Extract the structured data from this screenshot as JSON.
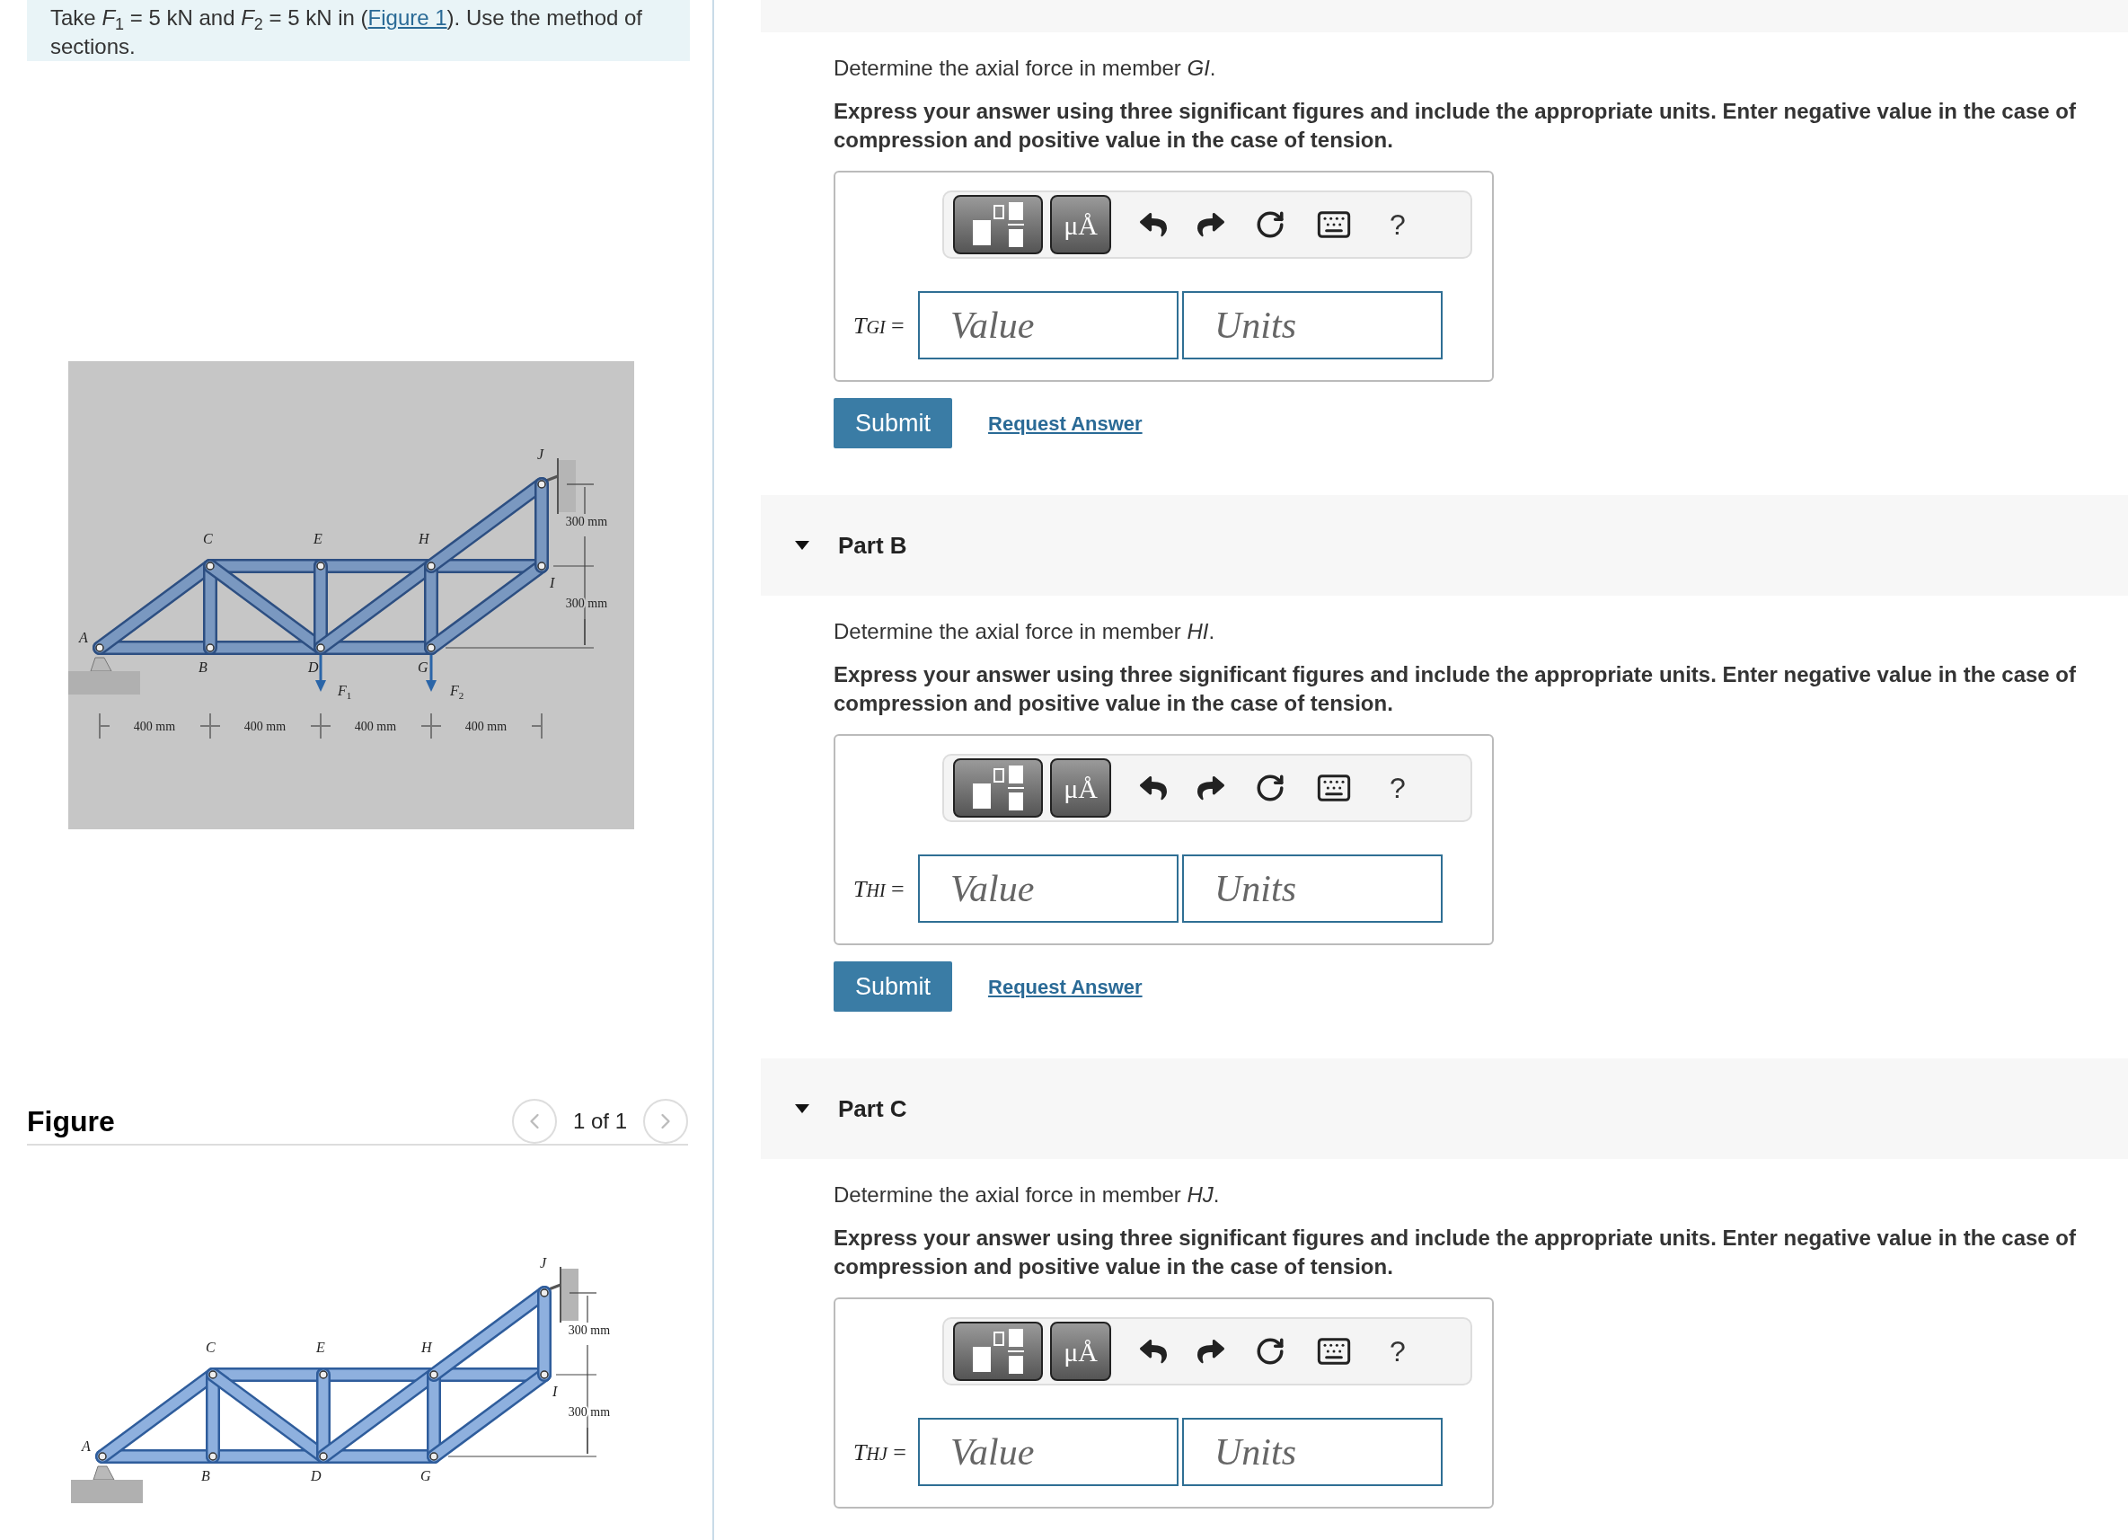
{
  "problem": {
    "before": "Take *F*$_{1}$ = 5 kN and *F*$_{2}$ = 5 kN in (",
    "link": "Figure 1",
    "after": "). Use the method of sections."
  },
  "figure_top": {
    "node_labels": [
      "A",
      "B",
      "C",
      "D",
      "E",
      "G",
      "H",
      "I",
      "J"
    ],
    "loads": [
      {
        "symbol": "F",
        "subscript": "1"
      },
      {
        "symbol": "F",
        "subscript": "2"
      }
    ],
    "horizontal_dimensions": [
      "400 mm",
      "400 mm",
      "400 mm",
      "400 mm"
    ],
    "vertical_dimensions": [
      "300 mm",
      "300 mm"
    ]
  },
  "figure_panel": {
    "title": "Figure",
    "pager": "1 of 1"
  },
  "figure_bottom": {
    "node_labels": [
      "A",
      "B",
      "C",
      "D",
      "E",
      "G",
      "H",
      "I",
      "J"
    ],
    "vertical_dimensions": [
      "300 mm",
      "300 mm"
    ]
  },
  "parts": [
    {
      "prompt": "Determine the axial force in member *GI*.",
      "instruction": "Express your answer using three significant figures and include the appropriate units. Enter negative value in the case of compression and positive value in the case of tension.",
      "templates_label": "μÅ",
      "help": "?",
      "symbol": "T",
      "subscript": "GI",
      "equals": "=",
      "value_placeholder": "Value",
      "units_placeholder": "Units",
      "submit": "Submit",
      "request": "Request Answer"
    },
    {
      "header": {
        "title": "Part B",
        "expanded": true
      },
      "prompt": "Determine the axial force in member *HI*.",
      "instruction": "Express your answer using three significant figures and include the appropriate units. Enter negative value in the case of compression and positive value in the case of tension.",
      "templates_label": "μÅ",
      "help": "?",
      "symbol": "T",
      "subscript": "HI",
      "equals": "=",
      "value_placeholder": "Value",
      "units_placeholder": "Units",
      "submit": "Submit",
      "request": "Request Answer"
    },
    {
      "header": {
        "title": "Part C",
        "expanded": true
      },
      "prompt": "Determine the axial force in member *HJ*.",
      "instruction": "Express your answer using three significant figures and include the appropriate units. Enter negative value in the case of compression and positive value in the case of tension.",
      "templates_label": "μÅ",
      "help": "?",
      "symbol": "T",
      "subscript": "HJ",
      "equals": "=",
      "value_placeholder": "Value",
      "units_placeholder": "Units"
    }
  ]
}
